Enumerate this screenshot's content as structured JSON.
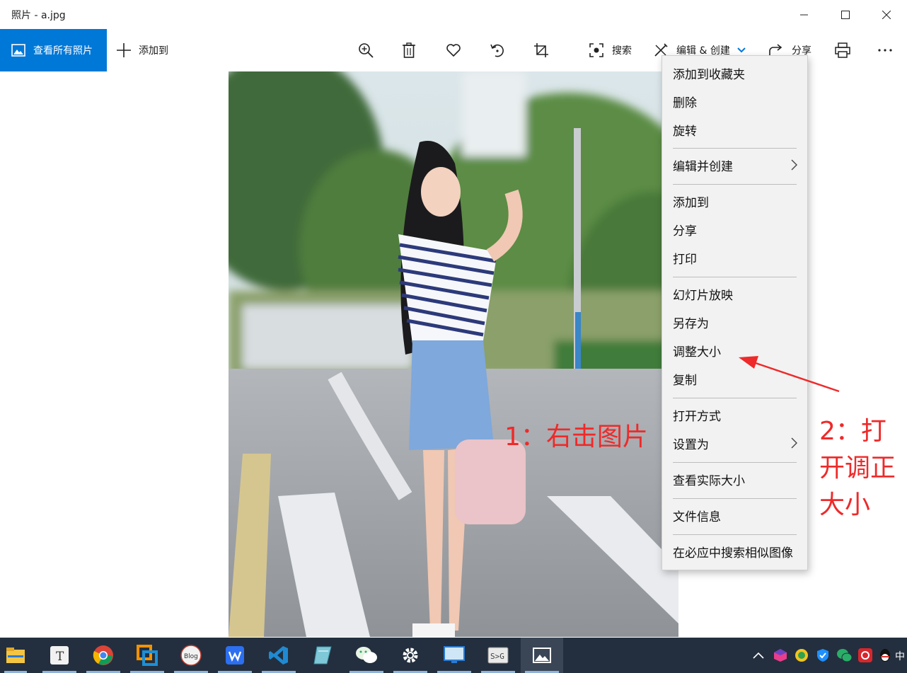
{
  "window": {
    "title": "照片 - a.jpg"
  },
  "toolbar": {
    "view_all_label": "查看所有照片",
    "add_to_label": "添加到",
    "search_label": "搜索",
    "edit_create_label": "编辑 & 创建",
    "share_label": "分享"
  },
  "context_menu": {
    "items": [
      {
        "label": "添加到收藏夹"
      },
      {
        "label": "删除"
      },
      {
        "label": "旋转"
      },
      {
        "label": "编辑并创建",
        "submenu": true
      },
      {
        "label": "添加到"
      },
      {
        "label": "分享"
      },
      {
        "label": "打印"
      },
      {
        "label": "幻灯片放映"
      },
      {
        "label": "另存为"
      },
      {
        "label": "调整大小"
      },
      {
        "label": "复制"
      },
      {
        "label": "打开方式"
      },
      {
        "label": "设置为",
        "submenu": true
      },
      {
        "label": "查看实际大小"
      },
      {
        "label": "文件信息"
      },
      {
        "label": "在必应中搜索相似图像"
      }
    ]
  },
  "annotations": {
    "step1": "1：右击图片",
    "step2_line1": "2：打",
    "step2_line2": "开调正",
    "step2_line3": "大小"
  },
  "taskbar": {
    "apps": [
      "file-explorer-icon",
      "typora-icon",
      "chrome-icon",
      "vmware-icon",
      "csdn-blog-icon",
      "wps-writer-icon",
      "vscode-icon",
      "notes-icon",
      "wechat-icon",
      "settings-icon",
      "remote-desktop-icon",
      "sublime-icon",
      "photos-icon"
    ],
    "active_app": "photos-icon"
  },
  "colors": {
    "accent": "#0078d7",
    "annotation": "#ee2a2a",
    "menu_bg": "#f2f2f2",
    "taskbar_bg": "#232f3e"
  }
}
